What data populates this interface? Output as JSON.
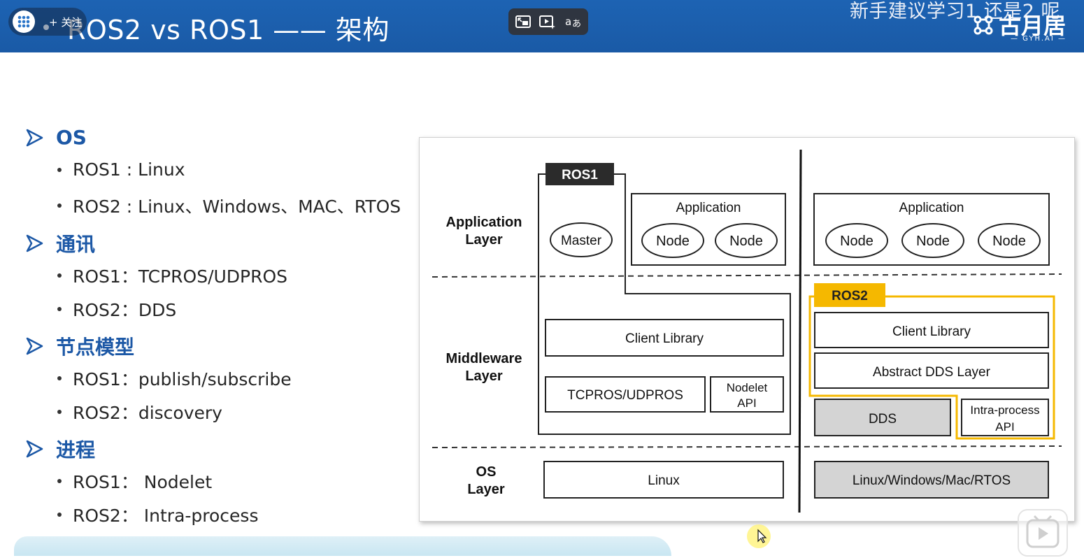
{
  "header": {
    "title": "ROS2 vs ROS1 —— 架构",
    "follow_label": "+ 关注",
    "marquee_text": "新手建议学习1 还是2 呢",
    "logo_text": "古月居",
    "logo_sub": "— GYH.AI —"
  },
  "toolbar": {
    "icons": [
      "pip-icon",
      "ai-play-icon",
      "translate-icon"
    ]
  },
  "sections": [
    {
      "title": "OS",
      "items": [
        "ROS1 : Linux",
        "ROS2 : Linux、Windows、MAC、RTOS"
      ]
    },
    {
      "title": "通讯",
      "items": [
        "ROS1：TCPROS/UDPROS",
        "ROS2：DDS"
      ]
    },
    {
      "title": "节点模型",
      "items": [
        "ROS1：publish/subscribe",
        "ROS2：discovery"
      ]
    },
    {
      "title": "进程",
      "items": [
        "ROS1： Nodelet",
        "ROS2： Intra-process"
      ]
    }
  ],
  "diagram": {
    "layers": {
      "application": "Application\nLayer",
      "middleware": "Middleware\nLayer",
      "os": "OS\nLayer"
    },
    "ros1": {
      "tag": "ROS1",
      "master": "Master",
      "application": "Application",
      "nodes": [
        "Node",
        "Node"
      ],
      "client_library": "Client Library",
      "transport": "TCPROS/UDPROS",
      "nodelet": "Nodelet\nAPI",
      "os": "Linux"
    },
    "ros2": {
      "tag": "ROS2",
      "application": "Application",
      "nodes": [
        "Node",
        "Node",
        "Node"
      ],
      "client_library": "Client Library",
      "abstract_dds": "Abstract DDS Layer",
      "dds": "DDS",
      "intra_process": "Intra-process\nAPI",
      "os": "Linux/Windows/Mac/RTOS"
    },
    "colors": {
      "ros2_highlight": "#f5b800",
      "gray_fill": "#d4d4d4",
      "tag_dark": "#2b2b2b"
    }
  }
}
